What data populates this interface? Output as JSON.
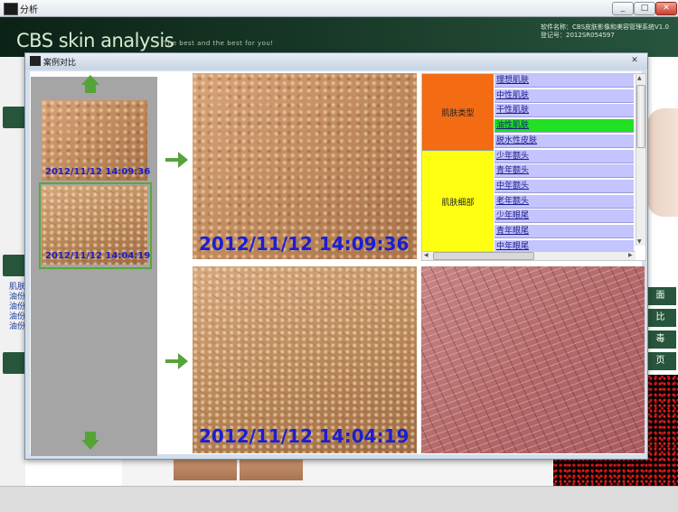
{
  "app": {
    "title": "分析",
    "brand": "CBS skin analysis",
    "slogan": "The best and the best for you!",
    "software_name": "软件名称：CBS皮肤影像和美容管理系统V1.0",
    "registration": "登记号：2012SR054597",
    "window_buttons": [
      "_",
      "□",
      "✕"
    ]
  },
  "background": {
    "side_list": [
      "肌肤",
      "油份",
      "油份",
      "油份",
      "油份"
    ],
    "right_buttons": [
      "面",
      "比",
      "毒",
      "页"
    ]
  },
  "dialog": {
    "title": "案例对比",
    "close": "✕",
    "thumbnails": [
      {
        "timestamp": "2012/11/12 14:09:36"
      },
      {
        "timestamp": "2012/11/12 14:04:19"
      }
    ],
    "image_a_timestamp": "2012/11/12 14:09:36",
    "image_b_timestamp": "2012/11/12 14:04:19",
    "classification": {
      "groups": [
        {
          "label": "肌肤类型"
        },
        {
          "label": "肌肤细部"
        }
      ],
      "rows": [
        {
          "label": "理想肌肤",
          "selected": false
        },
        {
          "label": "中性肌肤",
          "selected": false
        },
        {
          "label": "干性肌肤",
          "selected": false
        },
        {
          "label": "油性肌肤",
          "selected": true
        },
        {
          "label": "脱水性皮肤",
          "selected": false
        },
        {
          "label": "少年额头",
          "selected": false
        },
        {
          "label": "青年额头",
          "selected": false
        },
        {
          "label": "中年额头",
          "selected": false
        },
        {
          "label": "老年额头",
          "selected": false
        },
        {
          "label": "少年眼尾",
          "selected": false
        },
        {
          "label": "青年眼尾",
          "selected": false
        },
        {
          "label": "中年眼尾",
          "selected": false
        }
      ]
    },
    "colors": {
      "type_group": "#f36b13",
      "detail_group": "#ffff12",
      "row": "#c4c4ff",
      "selected_row": "#22e022",
      "accent": "#56a33a",
      "timestamp": "#1b1fd0"
    }
  }
}
